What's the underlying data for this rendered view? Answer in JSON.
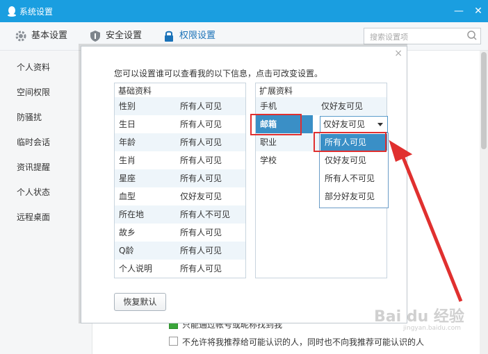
{
  "window": {
    "title": "系统设置",
    "minimize": "—",
    "close": "✕"
  },
  "toolbar": {
    "tabs": [
      {
        "label": "基本设置",
        "icon": "gear-icon"
      },
      {
        "label": "安全设置",
        "icon": "shield-icon"
      },
      {
        "label": "权限设置",
        "icon": "lock-icon"
      }
    ],
    "search_placeholder": "搜索设置项"
  },
  "sidebar": {
    "items": [
      {
        "label": "个人资料"
      },
      {
        "label": "空间权限"
      },
      {
        "label": "防骚扰"
      },
      {
        "label": "临时会话"
      },
      {
        "label": "资讯提醒"
      },
      {
        "label": "个人状态"
      },
      {
        "label": "远程桌面"
      }
    ]
  },
  "background": {
    "line1": "只能通过帐号或昵称找到我",
    "line2": "不允许将我推荐给可能认识的人，同时也不向我推荐可能认识的人"
  },
  "dialog": {
    "close": "×",
    "intro": "您可以设置谁可以查看我的以下信息，点击可改变设置。",
    "basic": {
      "header": "基础资料",
      "rows": [
        {
          "k": "性别",
          "v": "所有人可见"
        },
        {
          "k": "生日",
          "v": "所有人可见"
        },
        {
          "k": "年龄",
          "v": "所有人可见"
        },
        {
          "k": "生肖",
          "v": "所有人可见"
        },
        {
          "k": "星座",
          "v": "所有人可见"
        },
        {
          "k": "血型",
          "v": "仅好友可见"
        },
        {
          "k": "所在地",
          "v": "所有人不可见"
        },
        {
          "k": "故乡",
          "v": "所有人可见"
        },
        {
          "k": "Q龄",
          "v": "所有人可见"
        },
        {
          "k": "个人说明",
          "v": "所有人可见"
        }
      ]
    },
    "extended": {
      "header": "扩展资料",
      "rows": [
        {
          "k": "手机",
          "v": "仅好友可见"
        },
        {
          "k": "邮箱",
          "v": "仅好友可见"
        },
        {
          "k": "职业",
          "v": ""
        },
        {
          "k": "学校",
          "v": ""
        }
      ]
    },
    "dropdown_options": [
      "所有人可见",
      "仅好友可见",
      "所有人不可见",
      "部分好友可见"
    ],
    "restore_button": "恢复默认"
  },
  "watermark": {
    "text": "Bai du 经验",
    "sub": "jingyan.baidu.com"
  },
  "colors": {
    "titlebar": "#1a9ee0",
    "selection": "#3a8fc6",
    "annotation_red": "#e0302f"
  }
}
